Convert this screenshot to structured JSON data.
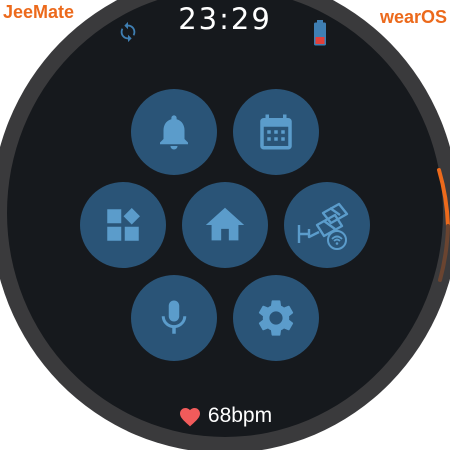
{
  "brand": {
    "left_label": "JeeMate",
    "right_label": "wearOS",
    "color": "#ec6a1c"
  },
  "status": {
    "time": "23:29",
    "sync_icon": "sync-icon",
    "battery_icon": "battery-low-icon",
    "battery_level": 0.15
  },
  "tiles": [
    {
      "icon": "bell-icon",
      "label": "Notifications"
    },
    {
      "icon": "calendar-icon",
      "label": "Calendar"
    },
    {
      "icon": "dashboard-icon",
      "label": "Dashboard"
    },
    {
      "icon": "home-icon",
      "label": "Home"
    },
    {
      "icon": "security-camera-icon",
      "label": "Cameras"
    },
    {
      "icon": "microphone-icon",
      "label": "Voice"
    },
    {
      "icon": "gear-icon",
      "label": "Settings"
    }
  ],
  "health": {
    "heart_icon": "heart-icon",
    "heart_rate": "68bpm"
  },
  "colors": {
    "screen": "#16191d",
    "bezel": "#3a3a3c",
    "tile": "#2a5477",
    "icon": "#5b9ccb",
    "heart": "#f15b5b",
    "crown_accent": "#ec6a1c"
  }
}
